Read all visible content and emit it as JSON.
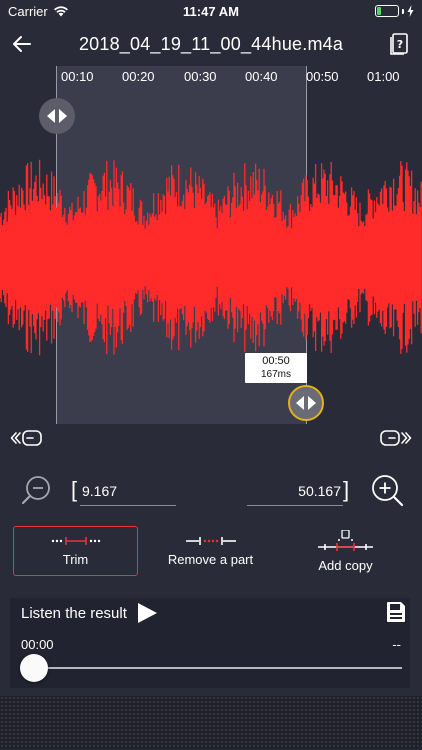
{
  "status_bar": {
    "carrier": "Carrier",
    "time": "11:47 AM",
    "battery_level": 0.2,
    "battery_color": "#4cd964"
  },
  "nav": {
    "title": "2018_04_19_11_00_44hue.m4a",
    "back_icon": "arrow-left-icon",
    "help_icon": "help-book-icon"
  },
  "timeline": {
    "ticks": [
      "00:10",
      "00:20",
      "00:30",
      "00:40",
      "00:50",
      "01:00"
    ],
    "tooltip_time": "00:50",
    "tooltip_ms": "167ms",
    "waveform_color": "#ff2a2a",
    "selection_color": "#3b3c4c",
    "handle_active_color": "#e0b21c"
  },
  "range": {
    "open_bracket": "[",
    "close_bracket": "]",
    "start_value": "9.167",
    "end_value": "50.167",
    "zoom_out_icon": "zoom-out-icon",
    "zoom_in_icon": "zoom-in-icon"
  },
  "modes": {
    "trim": "Trim",
    "remove": "Remove a part",
    "copy": "Add copy",
    "selected": "trim",
    "accent_color": "#e8323c"
  },
  "listen": {
    "label": "Listen the result",
    "current_time": "00:00",
    "duration": "--",
    "progress": 0
  }
}
